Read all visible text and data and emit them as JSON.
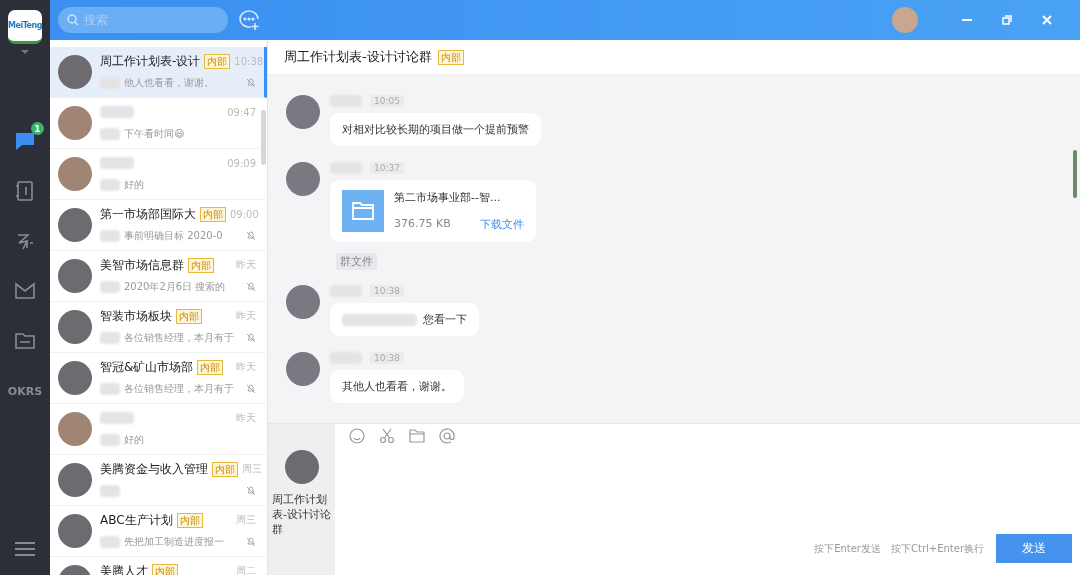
{
  "logo": {
    "text": "MeiTeng"
  },
  "search": {
    "placeholder": "搜索"
  },
  "nav": [
    {
      "kind": "chat",
      "badge": "1",
      "selected": true
    },
    {
      "kind": "notebook",
      "selected": false
    },
    {
      "kind": "flow",
      "selected": false
    },
    {
      "kind": "mail",
      "selected": false
    },
    {
      "kind": "folder",
      "selected": false
    },
    {
      "kind": "text",
      "label": "OKRS",
      "selected": false
    }
  ],
  "chats": [
    {
      "name": "周工作计划表-设计",
      "badge": "内部",
      "time": "10:38",
      "preview": "他人也看看，谢谢。",
      "muted": true,
      "selected": true
    },
    {
      "time": "09:47",
      "preview": "下午看时间😃",
      "muted": false,
      "selected": false
    },
    {
      "time": "09:09",
      "preview": "好的",
      "muted": false,
      "selected": false
    },
    {
      "name": "第一市场部国际大",
      "badge": "内部",
      "time": "09:00",
      "preview": "事前明确目标 2020-0",
      "muted": true,
      "selected": false
    },
    {
      "name": "美智市场信息群",
      "badge": "内部",
      "time": "昨天",
      "preview": "2020年2月6日 搜索的",
      "muted": true,
      "selected": false
    },
    {
      "name": "智装市场板块",
      "badge": "内部",
      "time": "昨天",
      "preview": "各位销售经理，本月有于",
      "muted": true,
      "selected": false
    },
    {
      "name": "智冠&矿山市场部",
      "badge": "内部",
      "time": "昨天",
      "preview": "各位销售经理，本月有于",
      "muted": true,
      "selected": false
    },
    {
      "time": "昨天",
      "preview": "好的",
      "muted": false,
      "selected": false
    },
    {
      "name": "美腾资金与收入管理",
      "badge": "内部",
      "time": "周三",
      "muted": true,
      "selected": false
    },
    {
      "name": "ABC生产计划",
      "badge": "内部",
      "time": "周三",
      "preview": "先把加工制造进度报一",
      "muted": true,
      "selected": false
    },
    {
      "name": "美腾人才",
      "badge": "内部",
      "time": "周二",
      "muted": false,
      "selected": false
    }
  ],
  "conversation": {
    "title": "周工作计划表-设计讨论群",
    "badge": "内部",
    "messages": [
      {
        "kind": "text",
        "time": "10:05",
        "text": "对相对比较长期的项目做一个提前预警"
      },
      {
        "kind": "file",
        "time": "10:37",
        "file_name": "第二市场事业部--智...",
        "file_size": "376.75 KB",
        "action": "下载文件",
        "tag": "群文件"
      },
      {
        "kind": "text",
        "time": "10:38",
        "text": "您看一下",
        "redacted_prefix": true
      },
      {
        "kind": "text",
        "time": "10:38",
        "text": "其他人也看看，谢谢。"
      }
    ]
  },
  "composer": {
    "group_name": "周工作计划表-设计讨论群",
    "hint_send": "按下Enter发送",
    "hint_newline": "按下Ctrl+Enter换行",
    "send": "发送"
  }
}
